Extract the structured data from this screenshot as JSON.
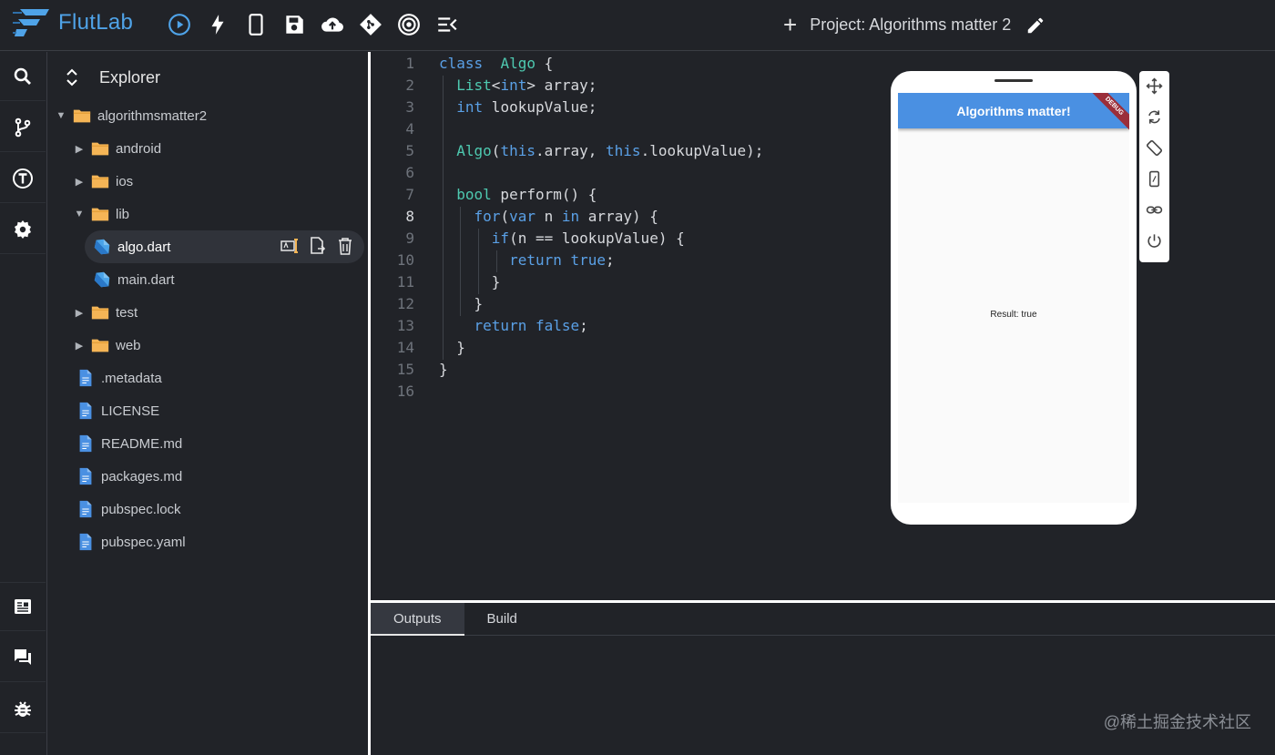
{
  "app": {
    "name": "FlutLab"
  },
  "toolbar": {
    "icons": [
      "play-circle-icon",
      "flash-icon",
      "phone-icon",
      "save-icon",
      "cloud-upload-icon",
      "git-icon",
      "target-icon",
      "collapse-menu-icon"
    ]
  },
  "project": {
    "add_symbol": "+",
    "title": "Project: Algorithms matter 2"
  },
  "sidebar": {
    "top_icons": [
      "search-icon",
      "git-branch-icon",
      "t-circle-icon",
      "settings-icon"
    ],
    "bottom_icons": [
      "article-icon",
      "chat-icon",
      "bug-icon"
    ]
  },
  "explorer": {
    "title": "Explorer",
    "tree": [
      {
        "label": "algorithmsmatter2",
        "kind": "folder",
        "expanded": true
      },
      {
        "label": "android",
        "kind": "folder",
        "expanded": false
      },
      {
        "label": "ios",
        "kind": "folder",
        "expanded": false
      },
      {
        "label": "lib",
        "kind": "folder",
        "expanded": true
      },
      {
        "label": "algo.dart",
        "kind": "dart",
        "selected": true
      },
      {
        "label": "main.dart",
        "kind": "dart"
      },
      {
        "label": "test",
        "kind": "folder",
        "expanded": false
      },
      {
        "label": "web",
        "kind": "folder",
        "expanded": false
      },
      {
        "label": ".metadata",
        "kind": "file"
      },
      {
        "label": "LICENSE",
        "kind": "file"
      },
      {
        "label": "README.md",
        "kind": "file"
      },
      {
        "label": "packages.md",
        "kind": "file"
      },
      {
        "label": "pubspec.lock",
        "kind": "file"
      },
      {
        "label": "pubspec.yaml",
        "kind": "file"
      }
    ]
  },
  "editor": {
    "active_line": 8,
    "lines": [
      [
        [
          "kw",
          "class"
        ],
        [
          "",
          "  "
        ],
        [
          "ty",
          "Algo"
        ],
        [
          "",
          " {"
        ]
      ],
      [
        [
          "",
          ""
        ],
        [
          "ty",
          "  List"
        ],
        [
          "",
          "<"
        ],
        [
          "kw",
          "int"
        ],
        [
          "",
          "> array;"
        ]
      ],
      [
        [
          "kw",
          "  int"
        ],
        [
          "",
          " lookupValue;"
        ]
      ],
      [],
      [
        [
          "ty",
          "  Algo"
        ],
        [
          "",
          "("
        ],
        [
          "kw",
          "this"
        ],
        [
          "",
          ".array, "
        ],
        [
          "kw",
          "this"
        ],
        [
          "",
          ".lookupValue);"
        ]
      ],
      [],
      [
        [
          "ty",
          "  bool"
        ],
        [
          "",
          " perform() {"
        ]
      ],
      [
        [
          "kw",
          "    for"
        ],
        [
          "",
          "("
        ],
        [
          "kw",
          "var"
        ],
        [
          "",
          " n "
        ],
        [
          "kw",
          "in"
        ],
        [
          "",
          " array) {"
        ]
      ],
      [
        [
          "kw",
          "      if"
        ],
        [
          "",
          "(n == lookupValue) {"
        ]
      ],
      [
        [
          "kw",
          "        return"
        ],
        [
          "",
          " "
        ],
        [
          "kw",
          "true"
        ],
        [
          "",
          ";"
        ]
      ],
      [
        [
          "",
          "      }"
        ]
      ],
      [
        [
          "",
          "    }"
        ]
      ],
      [
        [
          "kw",
          "    return"
        ],
        [
          "",
          " "
        ],
        [
          "kw",
          "false"
        ],
        [
          "",
          ";"
        ]
      ],
      [
        [
          "",
          "  }"
        ]
      ],
      [
        [
          "",
          "}"
        ]
      ],
      []
    ]
  },
  "output_tabs": [
    "Outputs",
    "Build"
  ],
  "phone_preview": {
    "appbar_title": "Algorithms matter!",
    "debug_banner": "DEBUG",
    "result_text": "Result: true",
    "tools": [
      "move-icon",
      "rotate-icon",
      "screen-rotation-icon",
      "device-icon",
      "link-icon",
      "power-icon"
    ]
  },
  "watermark": "@稀土掘金技术社区",
  "colors": {
    "accent": "#4fa3e8",
    "folder": "#f5b556",
    "keyword": "#5aa0e6",
    "type": "#4ec9b0",
    "appbar": "#4a90e2"
  }
}
